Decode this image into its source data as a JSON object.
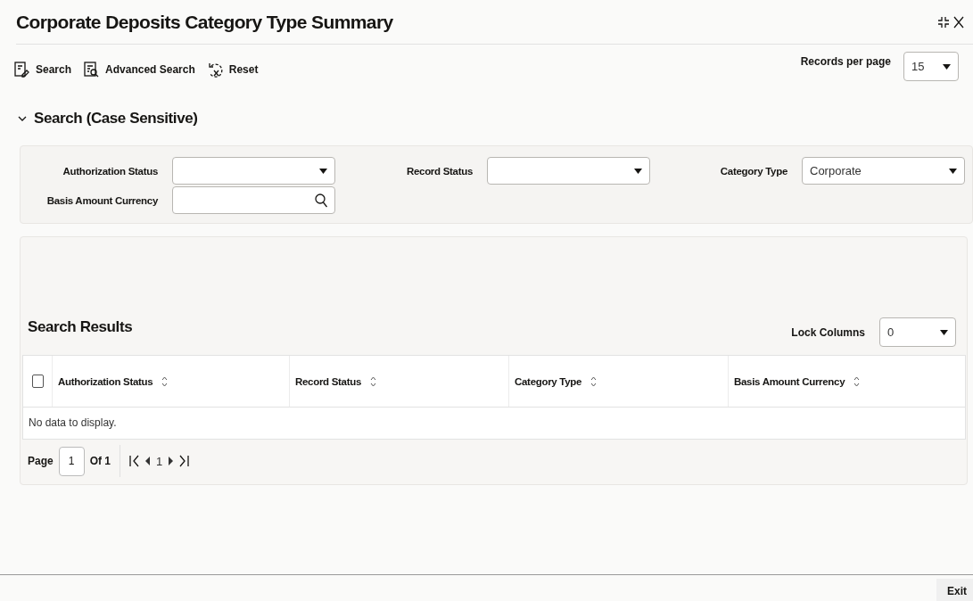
{
  "window": {
    "title": "Corporate Deposits Category Type Summary"
  },
  "toolbar": {
    "buttons": [
      {
        "label": "Search",
        "kind": "search"
      },
      {
        "label": "Advanced Search",
        "kind": "advanced"
      },
      {
        "label": "Reset",
        "kind": "reset"
      }
    ],
    "records_per_page": {
      "label": "Records per page",
      "value": "15"
    }
  },
  "search_section": {
    "title": "Search (Case Sensitive)",
    "expanded": true,
    "fields": [
      {
        "label": "Authorization Status",
        "kind": "select"
      },
      {
        "label": "Record Status",
        "kind": "select"
      },
      {
        "label": "Category Type",
        "kind": "select",
        "value": "Corporate"
      },
      {
        "label": "Basis Amount Currency",
        "kind": "lookup"
      }
    ]
  },
  "results": {
    "title": "Search Results",
    "lock_columns": {
      "label": "Lock Columns",
      "value": "0"
    },
    "select_all": {
      "checked": false
    },
    "columns": [
      "Authorization Status",
      "Record Status",
      "Category Type",
      "Basis Amount Currency"
    ],
    "empty_message": "No data to display.",
    "pagination": {
      "page_label": "Page",
      "page": "1",
      "of_label": "Of 1",
      "current": "1"
    }
  },
  "footer": {
    "buttons": [
      "Exit"
    ]
  }
}
